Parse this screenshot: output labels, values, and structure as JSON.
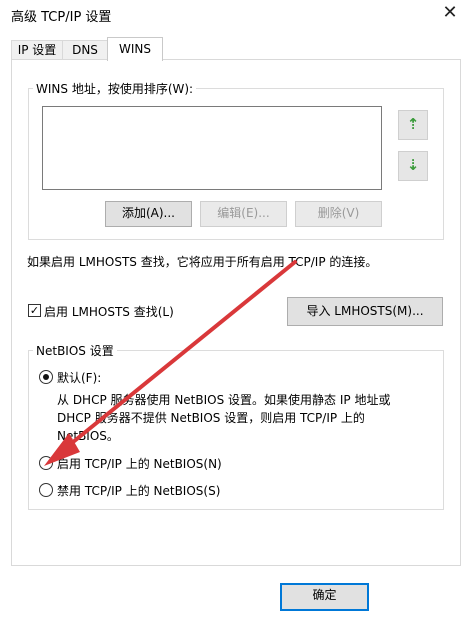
{
  "window": {
    "title": "高级 TCP/IP 设置",
    "close_glyph": "✕"
  },
  "tabs": [
    {
      "label": "IP 设置",
      "active": false
    },
    {
      "label": "DNS",
      "active": false
    },
    {
      "label": "WINS",
      "active": true
    }
  ],
  "wins": {
    "group_label": "WINS 地址，按使用排序(W):",
    "addresses": [],
    "move_up_glyph": "⇡",
    "move_down_glyph": "⇣",
    "add_label": "添加(A)...",
    "edit_label": "编辑(E)...",
    "remove_label": "删除(V)"
  },
  "lmhosts": {
    "info_text": "如果启用 LMHOSTS 查找，它将应用于所有启用 TCP/IP 的连接。",
    "checkbox_label": "启用 LMHOSTS 查找(L)",
    "checkbox_checked": true,
    "check_glyph": "✓",
    "import_label": "导入 LMHOSTS(M)..."
  },
  "netbios": {
    "group_label": "NetBIOS 设置",
    "options": [
      {
        "label": "默认(F):",
        "checked": true
      },
      {
        "label": "启用 TCP/IP 上的 NetBIOS(N)",
        "checked": false
      },
      {
        "label": "禁用 TCP/IP 上的 NetBIOS(S)",
        "checked": false
      }
    ],
    "default_description": [
      "从 DHCP 服务器使用 NetBIOS 设置。如果使用静态 IP 地址或",
      "DHCP 服务器不提供 NetBIOS 设置，则启用 TCP/IP 上的",
      "NetBIOS。"
    ]
  },
  "footer": {
    "ok_label": "确定"
  },
  "colors": {
    "annotation_arrow": "#d9383a",
    "accent": "#0078d7"
  }
}
